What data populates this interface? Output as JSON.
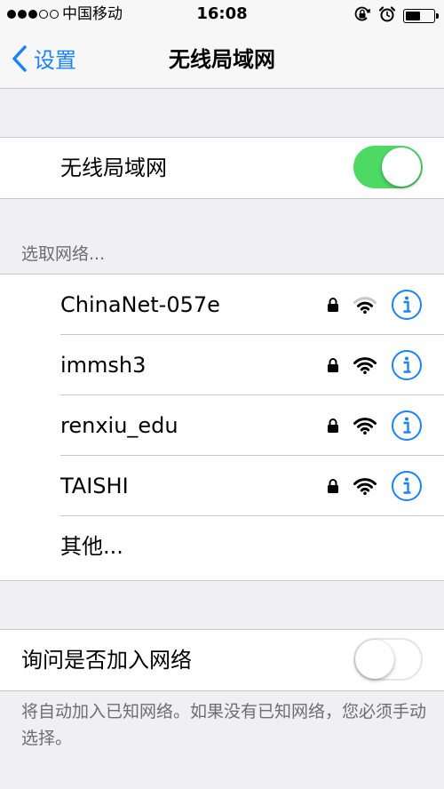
{
  "status_bar": {
    "carrier": "中国移动",
    "time": "16:08"
  },
  "nav": {
    "back_label": "设置",
    "title": "无线局域网"
  },
  "wifi": {
    "label": "无线局域网",
    "enabled": true
  },
  "networks": {
    "header": "选取网络...",
    "items": [
      {
        "name": "ChinaNet-057e",
        "locked": true
      },
      {
        "name": "immsh3",
        "locked": true
      },
      {
        "name": "renxiu_edu",
        "locked": true
      },
      {
        "name": "TAISHI",
        "locked": true
      }
    ],
    "other_label": "其他..."
  },
  "ask_to_join": {
    "label": "询问是否加入网络",
    "enabled": false,
    "footer": "将自动加入已知网络。如果没有已知网络，您必须手动选择。"
  },
  "colors": {
    "accent": "#1a82fb",
    "toggle_on": "#4cd964",
    "background": "#efeff4",
    "separator": "#c8c7cc"
  }
}
